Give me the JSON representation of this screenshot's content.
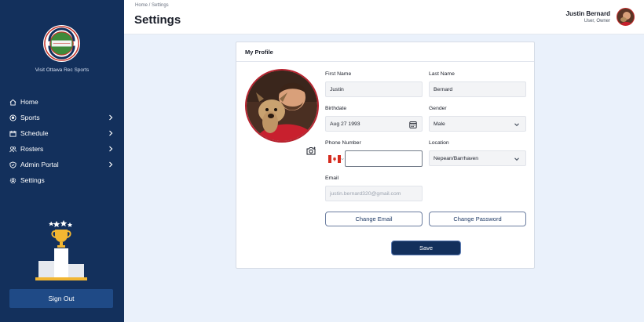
{
  "sidebar": {
    "logo_text": "OTTAWA REC SPORTS",
    "visit_link": "Visit Ottawa Rec Sports",
    "items": [
      {
        "label": "Home",
        "icon": "home-icon",
        "has_submenu": false
      },
      {
        "label": "Sports",
        "icon": "ball-icon",
        "has_submenu": true
      },
      {
        "label": "Schedule",
        "icon": "calendar-icon",
        "has_submenu": true
      },
      {
        "label": "Rosters",
        "icon": "users-icon",
        "has_submenu": true
      },
      {
        "label": "Admin Portal",
        "icon": "shield-icon",
        "has_submenu": true
      },
      {
        "label": "Settings",
        "icon": "gear-icon",
        "has_submenu": false
      }
    ],
    "sign_out": "Sign Out"
  },
  "header": {
    "breadcrumb": "Home / Settings",
    "title": "Settings",
    "user_name": "Justin Bernard",
    "user_role": "User, Owner"
  },
  "profile": {
    "card_title": "My Profile",
    "first_name_label": "First Name",
    "first_name": "Justin",
    "last_name_label": "Last Name",
    "last_name": "Bernard",
    "birthdate_label": "Birthdate",
    "birthdate": "Aug 27 1993",
    "gender_label": "Gender",
    "gender": "Male",
    "phone_label": "Phone Number",
    "phone": "",
    "location_label": "Location",
    "location": "Nepean/Barrhaven",
    "email_label": "Email",
    "email": "justin.bernard320@gmail.com",
    "change_email": "Change Email",
    "change_password": "Change Password",
    "save": "Save"
  },
  "colors": {
    "sidebar_bg": "#13305c",
    "page_bg": "#eaf1fb",
    "primary": "#13305c",
    "accent_gold": "#f2b632"
  }
}
